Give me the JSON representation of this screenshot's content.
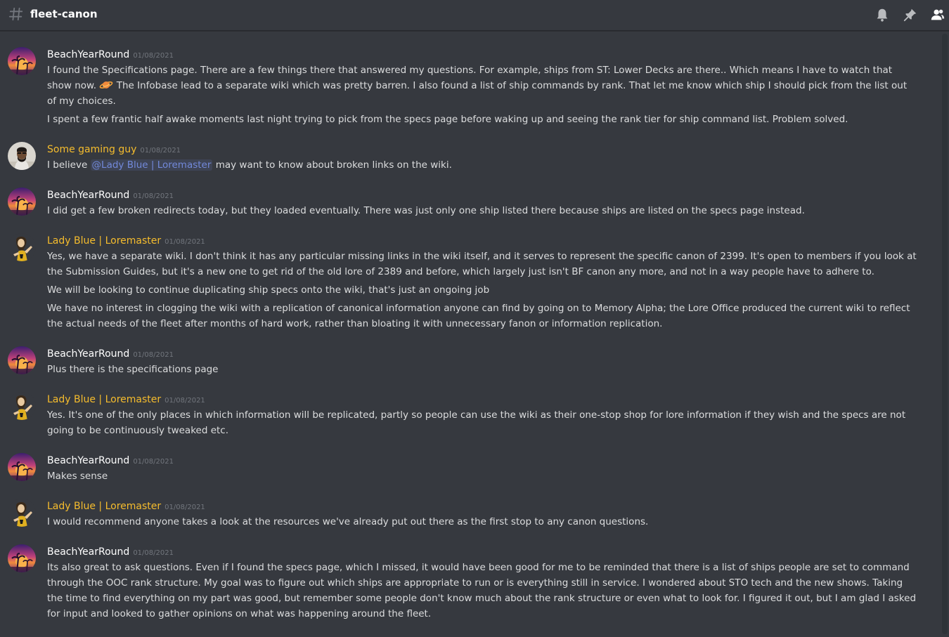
{
  "channel": {
    "name": "fleet-canon",
    "icons": [
      "hashtag-icon",
      "bell-icon",
      "pin-icon",
      "members-icon"
    ]
  },
  "colors": {
    "background": "#36393f",
    "username_default": "#ffffff",
    "username_gold": "#f5bc2d",
    "mention": "#7289da",
    "timestamp": "#72767d"
  },
  "messages": [
    {
      "author": "BeachYearRound",
      "timestamp": "01/08/2021",
      "lines": [
        "I found the Specifications page. There are a few things there that answered my questions. For example, ships from ST: Lower Decks are there.. Which means I have to watch that show",
        "now.",
        "The Infobase lead to a separate wiki which was pretty barren. I also found a list of ship commands by rank. That let me know which ship I should pick from the list out of my",
        "choices.",
        "I spent a few frantic half awake moments last night trying to pick from the specs page before waking up and seeing the rank tier for ship command list. Problem solved."
      ]
    },
    {
      "author": "Some gaming guy",
      "timestamp": "01/08/2021",
      "lines": [
        "I believe",
        "@Lady Blue | Loremaster",
        "may want to know about broken links on the wiki."
      ]
    },
    {
      "author": "BeachYearRound",
      "timestamp": "01/08/2021",
      "lines": [
        "I did get a few broken redirects today, but they loaded eventually. There was just only one ship listed there because ships are listed on the specs page instead."
      ]
    },
    {
      "author": "Lady Blue | Loremaster",
      "timestamp": "01/08/2021",
      "lines": [
        "Yes, we have a separate wiki. I don't think it has any particular missing links in the wiki itself, and it serves to represent the specific canon of 2399. It's open to members if you look at the Submission Guides, but it's a new one to get rid of the old lore of 2389 and before, which largely just isn't BF canon any more, and not in a way people have to adhere to.",
        "We will be looking to continue duplicating ship specs onto the wiki, that's just an ongoing job",
        "We have no interest in clogging the wiki with a replication of canonical information anyone can find by going on to Memory Alpha; the Lore Office produced the current wiki to reflect the actual needs of the fleet after months of hard work, rather than bloating it with unnecessary fanon or information replication."
      ]
    },
    {
      "author": "BeachYearRound",
      "timestamp": "01/08/2021",
      "lines": [
        "Plus there is the specifications page"
      ]
    },
    {
      "author": "Lady Blue | Loremaster",
      "timestamp": "01/08/2021",
      "lines": [
        "Yes. It's one of the only places in which information will be replicated, partly so people can use the wiki as their one-stop shop for lore information if they wish and the specs are not going to be continuously tweaked etc."
      ]
    },
    {
      "author": "BeachYearRound",
      "timestamp": "01/08/2021",
      "lines": [
        "Makes sense"
      ]
    },
    {
      "author": "Lady Blue | Loremaster",
      "timestamp": "01/08/2021",
      "lines": [
        "I would recommend anyone takes a look at the resources we've already put out there as the first stop to any canon questions."
      ]
    },
    {
      "author": "BeachYearRound",
      "timestamp": "01/08/2021",
      "lines": [
        "Its also great to ask questions. Even if I found the specs page, which I missed, it would have been good for me to be reminded that there is a list of ships people are set to command through the OOC rank structure. My goal was to figure out which ships are appropriate to run or is everything still in service. I wondered about STO tech and the new shows. Taking the time to find everything on my part was good, but remember some people don't know much about the rank structure or even what to look for. I figured it out, but I am glad I asked for input and looked to gather opinions on what was happening around the fleet."
      ]
    }
  ]
}
